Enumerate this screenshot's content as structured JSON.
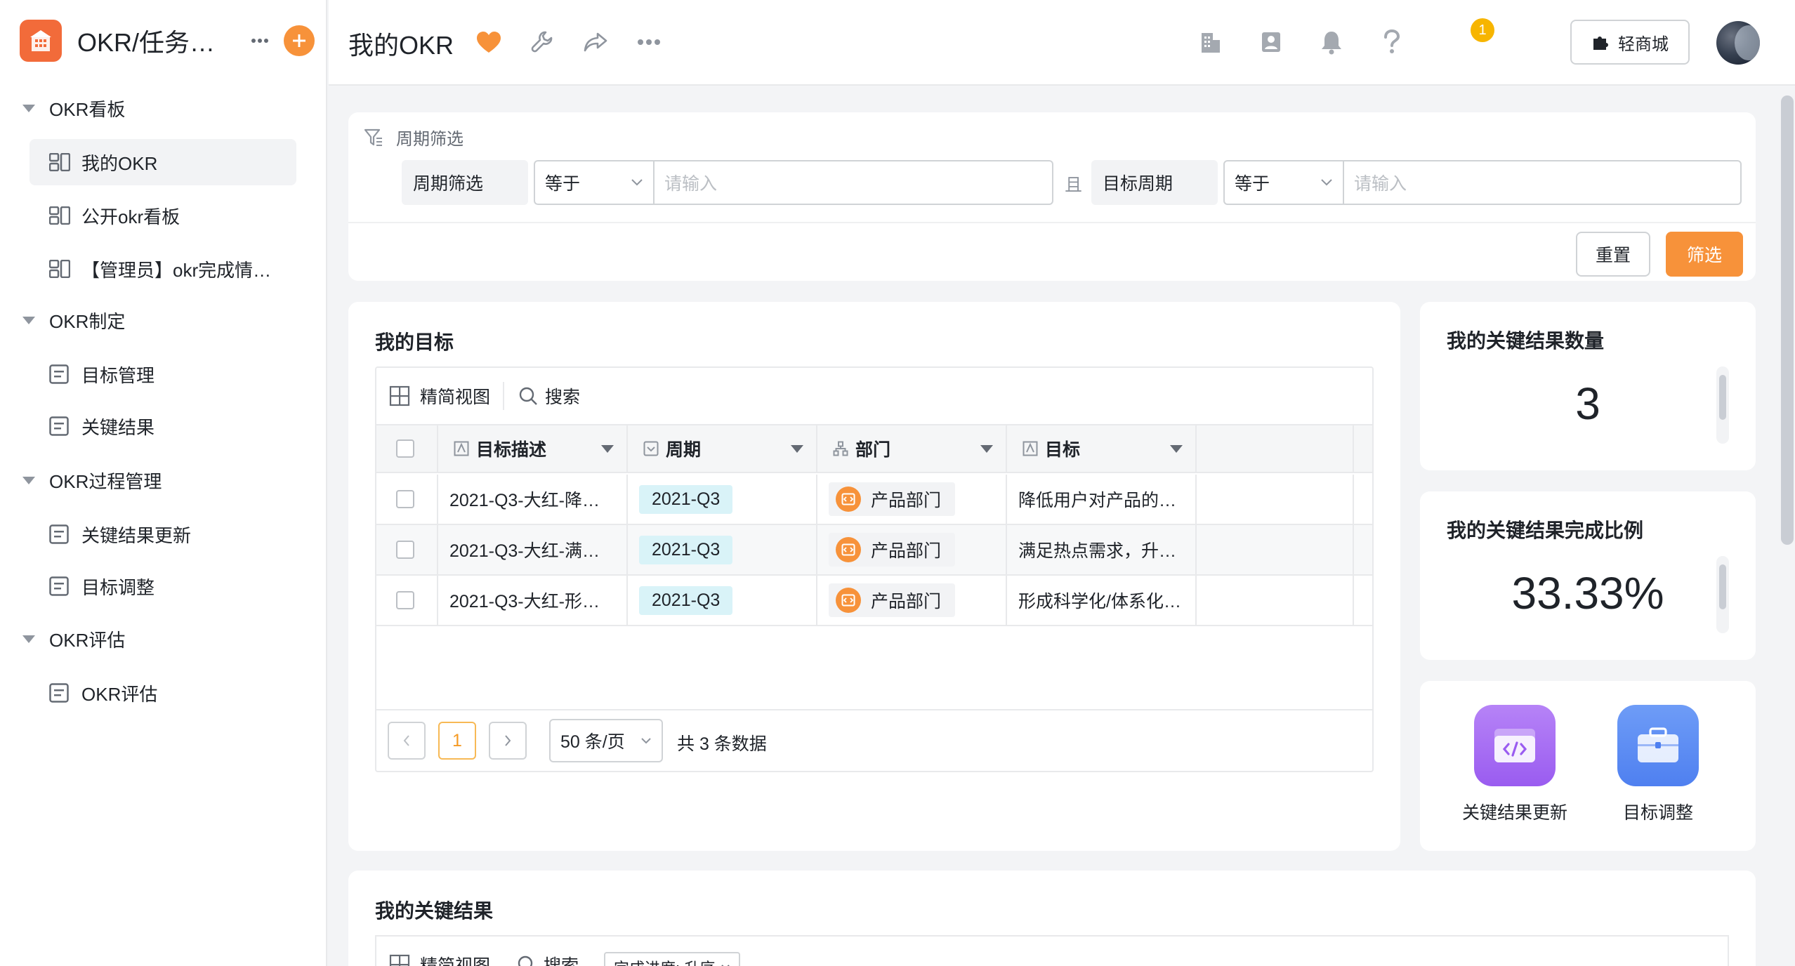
{
  "app": {
    "title": "OKR/任务…"
  },
  "sidebar": {
    "groups": [
      {
        "label": "OKR看板",
        "items": [
          {
            "label": "我的OKR",
            "icon": "board-icon",
            "active": true
          },
          {
            "label": "公开okr看板",
            "icon": "board-icon"
          },
          {
            "label": "【管理员】okr完成情…",
            "icon": "board-icon"
          }
        ]
      },
      {
        "label": "OKR制定",
        "items": [
          {
            "label": "目标管理",
            "icon": "form-icon"
          },
          {
            "label": "关键结果",
            "icon": "form-icon"
          }
        ]
      },
      {
        "label": "OKR过程管理",
        "items": [
          {
            "label": "关键结果更新",
            "icon": "form-icon"
          },
          {
            "label": "目标调整",
            "icon": "form-icon"
          }
        ]
      },
      {
        "label": "OKR评估",
        "items": [
          {
            "label": "OKR评估",
            "icon": "form-icon"
          }
        ]
      }
    ]
  },
  "header": {
    "page_title": "我的OKR",
    "notification_count": "1",
    "mall_label": "轻商城"
  },
  "filter": {
    "heading": "周期筛选",
    "conj": "且",
    "rows": [
      {
        "key": "周期筛选",
        "op": "等于",
        "placeholder": "请输入"
      },
      {
        "key": "目标周期",
        "op": "等于",
        "placeholder": "请输入"
      }
    ],
    "reset_label": "重置",
    "submit_label": "筛选"
  },
  "goals": {
    "title": "我的目标",
    "view_label": "精简视图",
    "search_label": "搜索",
    "columns": [
      "目标描述",
      "周期",
      "部门",
      "目标"
    ],
    "rows": [
      {
        "desc": "2021-Q3-大红-降…",
        "period": "2021-Q3",
        "dept": "产品部门",
        "goal": "降低用户对产品的…"
      },
      {
        "desc": "2021-Q3-大红-满…",
        "period": "2021-Q3",
        "dept": "产品部门",
        "goal": "满足热点需求，升…"
      },
      {
        "desc": "2021-Q3-大红-形…",
        "period": "2021-Q3",
        "dept": "产品部门",
        "goal": "形成科学化/体系化…"
      }
    ],
    "pager": {
      "current": "1",
      "page_size": "50 条/页",
      "total": "共 3 条数据"
    }
  },
  "stats": [
    {
      "title": "我的关键结果数量",
      "value": "3"
    },
    {
      "title": "我的关键结果完成比例",
      "value": "33.33%"
    }
  ],
  "quick_actions": [
    {
      "label": "关键结果更新",
      "color": "#a36bf0"
    },
    {
      "label": "目标调整",
      "color": "#5a8df5"
    }
  ],
  "key_results": {
    "title": "我的关键结果",
    "view_label": "精简视图",
    "search_label": "搜索",
    "sort_tag": "完成进度: 升序"
  },
  "colors": {
    "accent": "#f7923a",
    "brand": "#f26b3a"
  }
}
